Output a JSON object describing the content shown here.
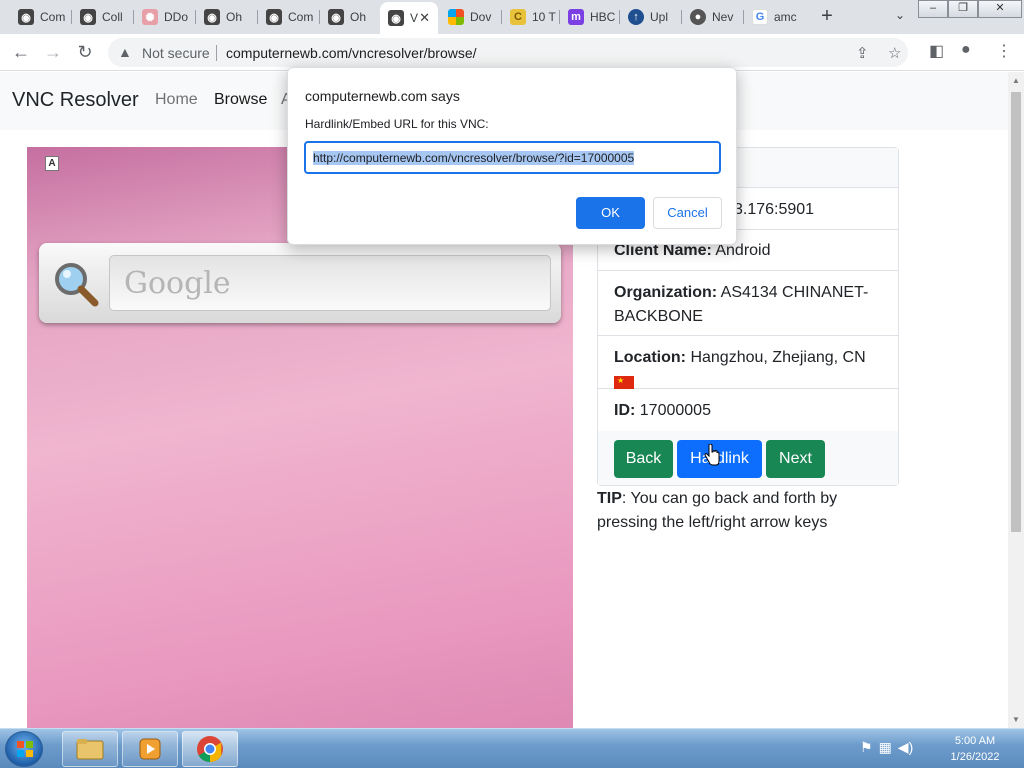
{
  "browser": {
    "tabs": [
      {
        "label": "Com",
        "icon": "vnc-icon"
      },
      {
        "label": "Coll",
        "icon": "vnc-icon"
      },
      {
        "label": "DDo",
        "icon": "ddos-icon"
      },
      {
        "label": "Oh",
        "icon": "vnc-icon"
      },
      {
        "label": "Com",
        "icon": "vnc-icon"
      },
      {
        "label": "Oh",
        "icon": "vnc-icon"
      },
      {
        "label": "V",
        "icon": "vnc-icon",
        "active": true
      },
      {
        "label": "Dov",
        "icon": "windows-icon"
      },
      {
        "label": "10 T",
        "icon": "c-icon"
      },
      {
        "label": "HBC",
        "icon": "m-icon"
      },
      {
        "label": "Upl",
        "icon": "upload-icon"
      },
      {
        "label": "Nev",
        "icon": "github-icon"
      },
      {
        "label": "amc",
        "icon": "google-icon"
      }
    ],
    "security_label": "Not secure",
    "url": "computernewb.com/vncresolver/browse/"
  },
  "page": {
    "brand": "VNC Resolver",
    "nav": {
      "home": "Home",
      "browse": "Browse",
      "about_partial": "A"
    },
    "screenshot": {
      "badge": "A",
      "search_widget_text": "Google"
    },
    "info": {
      "address_partial": "3.176:5901",
      "client_name_label": "Client Name:",
      "client_name_value": "Android",
      "organization_label": "Organization:",
      "organization_value": "AS4134 CHINANET-BACKBONE",
      "location_label": "Location:",
      "location_value": "Hangzhou, Zhejiang, CN",
      "id_label": "ID:",
      "id_value": "17000005"
    },
    "buttons": {
      "back": "Back",
      "hardlink": "Hardlink",
      "next": "Next"
    },
    "tip_label": "TIP",
    "tip_text": ": You can go back and forth by pressing the left/right arrow keys"
  },
  "dialog": {
    "title": "computernewb.com says",
    "message": "Hardlink/Embed URL for this VNC:",
    "value": "http://computernewb.com/vncresolver/browse/?id=17000005",
    "ok": "OK",
    "cancel": "Cancel"
  },
  "taskbar": {
    "time": "5:00 AM",
    "date": "1/26/2022"
  },
  "colors": {
    "btn_green": "#198754",
    "btn_blue": "#0d6efd",
    "dialog_accent": "#1a73e8"
  }
}
